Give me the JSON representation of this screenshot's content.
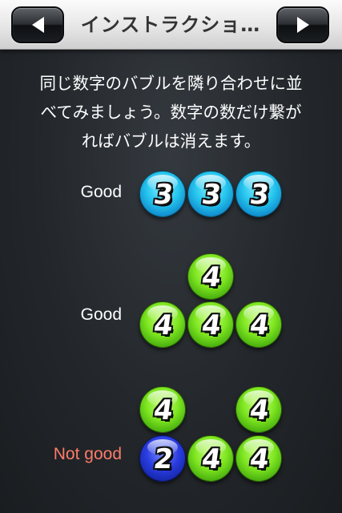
{
  "header": {
    "title": "インストラクショ…",
    "prev_icon": "triangle-left",
    "next_icon": "triangle-right"
  },
  "instructions": {
    "line1": "同じ数字のバブルを隣り合わせに並",
    "line2": "べてみましょう。数字の数だけ繋が",
    "line3": "ればバブルは消えます。"
  },
  "examples": [
    {
      "label": "Good",
      "bubbles": [
        {
          "number": "3",
          "color": "cyan"
        },
        {
          "number": "3",
          "color": "cyan"
        },
        {
          "number": "3",
          "color": "cyan"
        }
      ]
    },
    {
      "label": "Good",
      "bubbles": [
        {
          "number": "4",
          "color": "green"
        },
        {
          "number": "4",
          "color": "green"
        },
        {
          "number": "4",
          "color": "green"
        },
        {
          "number": "4",
          "color": "green"
        }
      ]
    },
    {
      "label": "Not good",
      "bubbles": [
        {
          "number": "4",
          "color": "green"
        },
        {
          "number": "4",
          "color": "green"
        },
        {
          "number": "2",
          "color": "blue"
        },
        {
          "number": "4",
          "color": "green"
        },
        {
          "number": "4",
          "color": "green"
        }
      ]
    }
  ],
  "colors": {
    "good_label": "#ffffff",
    "bad_label": "#ff7b6a",
    "cyan": "#25c4ee",
    "green": "#7ee620",
    "blue": "#2a3de0"
  }
}
